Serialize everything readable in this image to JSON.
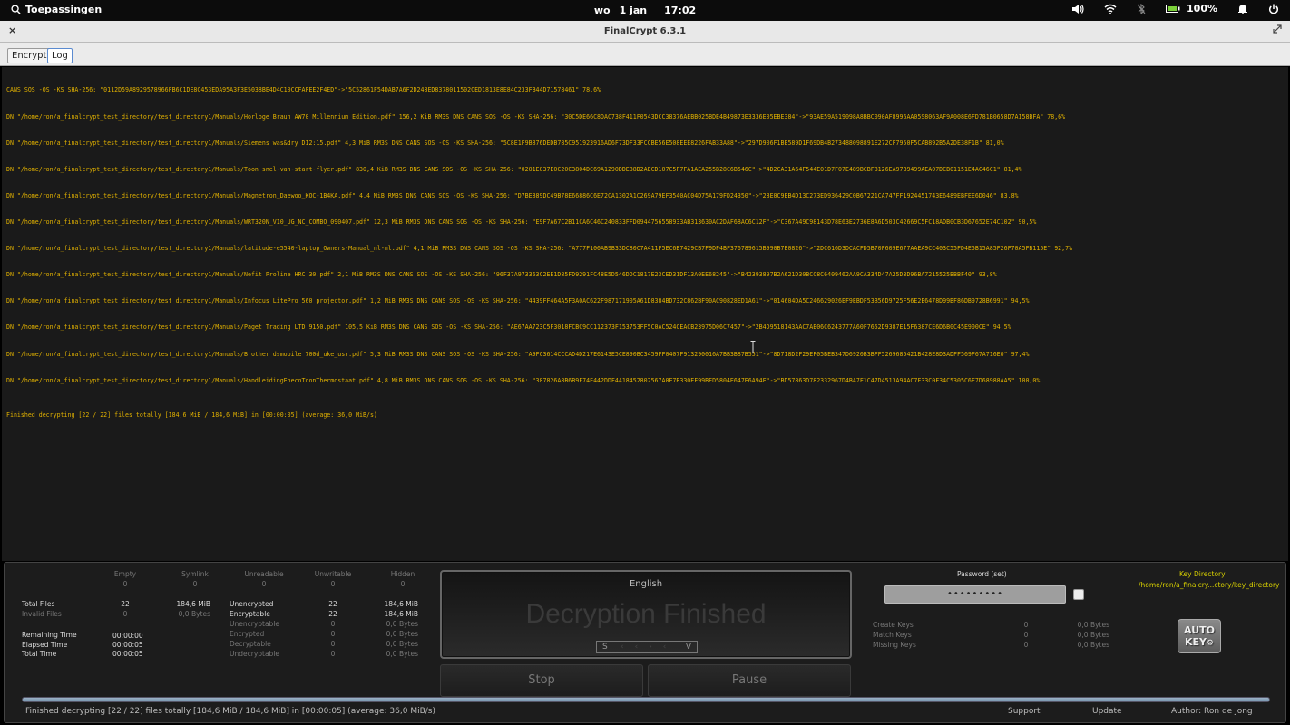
{
  "topbar": {
    "apps_label": "Toepassingen",
    "day": "wo",
    "date": "1 jan",
    "time": "17:02",
    "battery": "100%"
  },
  "window": {
    "title": "FinalCrypt 6.3.1",
    "close_glyph": "×"
  },
  "tabs": {
    "encrypt": "Encrypt",
    "log": "Log"
  },
  "log": {
    "lines": [
      "CANS SOS -OS -KS SHA-256: \"0112D59A8929578966FB6C1DE8C453EDA95A3F3E5038BE4D4C10CCFAFEE2F4ED\"->\"5C52861F54DAB7A6F2D248ED8378011502CED1813E8E84C233FB44D71578461\" 78,6%",
      "DN \"/home/ron/a_finalcrypt_test_directory/test_directory1/Manuals/Horloge Braun AW70 Millennium Edition.pdf\" 156,2 KiB RM3S DNS CANS SOS -OS -KS SHA-256: \"30C5DE66C8DAC738F411F0543DCC38376AEBB025BDE4B49873E3336E05EBE384\"->\"93AE59A519098A8BBC090AF8996AA05S8063AF9A008E6FD781B0658D7A158BFA\" 78,6%",
      "DN \"/home/ron/a_finalcrypt_test_directory/test_directory1/Manuals/Siemens was&dry D12:15.pdf\" 4,3 MiB RM3S DNS CANS SOS -OS -KS SHA-256: \"5C8E1F9B876DEDB785C951923916AD6F73DF33FCCBE56E508EEE8226FAB33A88\"->\"297D906F1BE589D1F69DB4B273488098891E272CF7950F5CAB892B5A2DE38F1B\" 81,0%",
      "DN \"/home/ron/a_finalcrypt_test_directory/test_directory1/Manuals/Toon snel-van-start-flyer.pdf\" 830,4 KiB RM3S DNS CANS SOS -OS -KS SHA-256: \"0201E037E0C20C3804DC69A1290DDE88D2AECD107C5F7FA1AEA255B28C6B546C\"->\"4D2CA31A64F544E01D7F07E489BCBF8126EA97B9499AEA07DCB01151E4AC46C1\" 81,4%",
      "DN \"/home/ron/a_finalcrypt_test_directory/test_directory1/Manuals/Magnetron_Daewoo_KOC-1B4KA.pdf\" 4,4 MiB RM3S DNS CANS SOS -OS -KS SHA-256: \"D7BE889DC49B78E66886C6E72CA1302A1C269A79EF3540AC04D75A179FD24350\"->\"28E0C9EB4D13C273ED936429C0B67221CA747FF1924451743E6489EBFEE6D046\" 83,8%",
      "DN \"/home/ron/a_finalcrypt_test_directory/test_directory1/Manuals/WRT320N_V10_UG_NC_COMBO_090407.pdf\" 12,3 MiB RM3S DNS CANS SOS -OS -KS SHA-256: \"E9F7A67C2B11CA6C46C240833FFD0944756558933AB313630AC2DAF68AC6C12F\"->\"C367A49C98143D78E63E2736E8A6D503C42669C5FC18ADB0CB3D67652E74C102\" 90,5%",
      "DN \"/home/ron/a_finalcrypt_test_directory/test_directory1/Manuals/latitude-e5540-laptop_Owners-Manual_nl-nl.pdf\" 4,1 MiB RM3S DNS CANS SOS -OS -KS SHA-256: \"A777F106AB9B33DC80C7A411F5EC6B7429CB7F9DF4BF376789615B990B7E0826\"->\"2DC616D3DCACFD5B70F609E677AAEA9CC403C55FD4E5B15A85F26F70A5FB115E\" 92,7%",
      "DN \"/home/ron/a_finalcrypt_test_directory/test_directory1/Manuals/Nefit Proline HRC 30.pdf\" 2,1 MiB RM3S DNS CANS SOS -OS -KS SHA-256: \"96F37A973363C2EE1D85FD9291FC48E5D546DDC1817E23CED31DF13A0EE68245\"->\"B42393897B2A621D30BCC8C6409462AA9CA334D47A25D3D96BA7215525BBBF40\" 93,8%",
      "DN \"/home/ron/a_finalcrypt_test_directory/test_directory1/Manuals/Infocus LitePro 560 projector.pdf\" 1,2 MiB RM3S DNS CANS SOS -OS -KS SHA-256: \"4439FF464A5F3A0AC622F987171905A61D8384BD732C862BF90AC90828ED1A61\"->\"014604DA5C246629026EF9EBDF53B56D9725F56E2E6478D99BF86DB9728B6991\" 94,5%",
      "DN \"/home/ron/a_finalcrypt_test_directory/test_directory1/Manuals/Paget Trading LTD 9150.pdf\" 105,5 KiB RM3S DNS CANS SOS -OS -KS SHA-256: \"AE67AA723C5F3018FCBC9CC112373F153753FF5C0AC524CEACB23975D06C7457\"->\"2B4D9518143AAC7AE06C6243777A60F7652D9387E15F6387CE6D6B0C45E900CE\" 94,5%",
      "DN \"/home/ron/a_finalcrypt_test_directory/test_directory1/Manuals/Brother dsmobile 700d_uke_usr.pdf\" 5,3 MiB RM3S DNS CANS SOS -OS -KS SHA-256: \"A9FC3614CCCAD4D217E6143E5CE890BC3459FF0407F913290016A7BB3B87B551\"->\"8D718D2F29EF05BEB347D6920B3BFF5269685421B428E8D3ADFF569F67A716E0\" 97,4%",
      "DN \"/home/ron/a_finalcrypt_test_directory/test_directory1/Manuals/HandleidingEnecoToonThermostaat.pdf\" 4,8 MiB RM3S DNS CANS SOS -OS -KS SHA-256: \"387826A8B6B9F74E442DDF4A18452802567A0E7B330EF99BED5804E647E6A94F\"->\"BD57863D782332967D4BA7F1C47D4513A94AC7F33C0F34C5305C6F7D68988AA5\" 100,0%"
    ],
    "finished": "Finished decrypting [22 / 22] files totally [184,6 MiB / 184,6 MiB] in [00:00:05] (average: 36,0 MiB/s)"
  },
  "stats": {
    "headers": {
      "empty": "Empty",
      "symlink": "Symlink",
      "unreadable": "Unreadable",
      "unwritable": "Unwritable",
      "hidden": "Hidden"
    },
    "header_values": {
      "empty": "0",
      "symlink": "0",
      "unreadable": "0",
      "unwritable": "0",
      "hidden": "0"
    },
    "total_files": {
      "label": "Total Files",
      "count": "22",
      "size": "184,6 MiB"
    },
    "invalid_files": {
      "label": "Invalid Files",
      "count": "0",
      "size": "0,0 Bytes"
    },
    "unencrypted": {
      "label": "Unencrypted",
      "count": "22",
      "size": "184,6 MiB"
    },
    "encryptable": {
      "label": "Encryptable",
      "count": "22",
      "size": "184,6 MiB"
    },
    "unencryptable": {
      "label": "Unencryptable",
      "count": "0",
      "size": "0,0 Bytes"
    },
    "encrypted": {
      "label": "Encrypted",
      "count": "0",
      "size": "0,0 Bytes"
    },
    "decryptable": {
      "label": "Decryptable",
      "count": "0",
      "size": "0,0 Bytes"
    },
    "undecryptable": {
      "label": "Undecryptable",
      "count": "0",
      "size": "0,0 Bytes"
    },
    "remaining_time": {
      "label": "Remaining Time",
      "value": "00:00:00"
    },
    "elapsed_time": {
      "label": "Elapsed Time",
      "value": "00:00:05"
    },
    "total_time": {
      "label": "Total Time",
      "value": "00:00:05"
    }
  },
  "display": {
    "language": "English",
    "message": "Decryption Finished",
    "s_label": "S",
    "v_label": "V"
  },
  "buttons": {
    "stop": "Stop",
    "pause": "Pause"
  },
  "password": {
    "label": "Password (set)",
    "value": "•••••••••"
  },
  "keys": {
    "create": {
      "label": "Create Keys",
      "count": "0",
      "size": "0,0 Bytes"
    },
    "match": {
      "label": "Match Keys",
      "count": "0",
      "size": "0,0 Bytes"
    },
    "missing": {
      "label": "Missing Keys",
      "count": "0",
      "size": "0,0 Bytes"
    }
  },
  "key_directory": {
    "label": "Key Directory",
    "path": "/home/ron/a_finalcry...ctory/key_directory"
  },
  "autokey": {
    "line1": "AUTO",
    "line2": "KEY"
  },
  "progress": {
    "fraction": 1.0
  },
  "statusbar": {
    "message": "Finished decrypting [22 / 22] files totally [184,6 MiB / 184,6 MiB] in [00:00:05] (average: 36,0 MiB/s)",
    "support": "Support",
    "update": "Update",
    "author": "Author: Ron de Jong"
  },
  "colors": {
    "log_text": "#e0b000",
    "key_dir": "#d8d000",
    "progress": "#8aa6c0"
  }
}
